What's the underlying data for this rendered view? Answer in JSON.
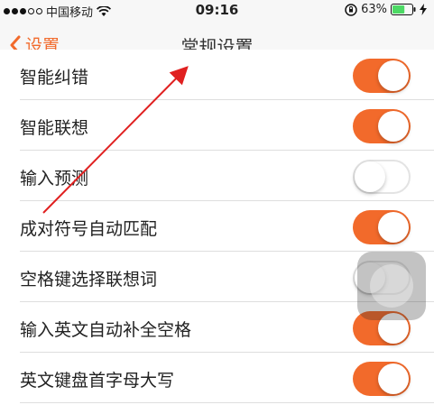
{
  "status_bar": {
    "carrier": "中国移动",
    "time": "09:16",
    "battery_percent": "63%",
    "battery_level": 0.63
  },
  "nav": {
    "back_label": "设置",
    "title": "常规设置"
  },
  "settings": [
    {
      "label": "智能纠错",
      "on": true
    },
    {
      "label": "智能联想",
      "on": true
    },
    {
      "label": "输入预测",
      "on": false
    },
    {
      "label": "成对符号自动匹配",
      "on": true
    },
    {
      "label": "空格键选择联想词",
      "on": false
    },
    {
      "label": "输入英文自动补全空格",
      "on": true
    },
    {
      "label": "英文键盘首字母大写",
      "on": true
    }
  ],
  "colors": {
    "accent": "#f26a2b",
    "annotation": "#e02020"
  }
}
